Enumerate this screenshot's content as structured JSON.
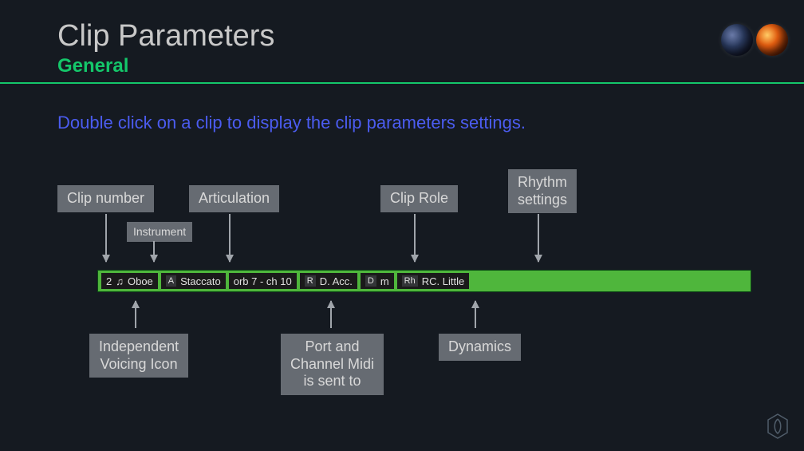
{
  "title": "Clip Parameters",
  "subtitle": "General",
  "instruction": "Double click on a clip to display the clip parameters settings.",
  "labels": {
    "clip_number": "Clip number",
    "instrument": "Instrument",
    "articulation": "Articulation",
    "clip_role": "Clip Role",
    "rhythm_settings": "Rhythm\nsettings",
    "independent_voicing": "Independent\nVoicing Icon",
    "port_channel": "Port and\nChannel Midi\nis sent to",
    "dynamics": "Dynamics"
  },
  "clip": {
    "number": "2",
    "instrument": "Oboe",
    "articulation_badge": "A",
    "articulation": "Staccato",
    "port_channel": "orb 7 - ch 10",
    "role_badge": "R",
    "role": "D. Acc.",
    "dynamics_badge": "D",
    "dynamics": "m",
    "rhythm_badge": "Rh",
    "rhythm": "RC. Little"
  }
}
